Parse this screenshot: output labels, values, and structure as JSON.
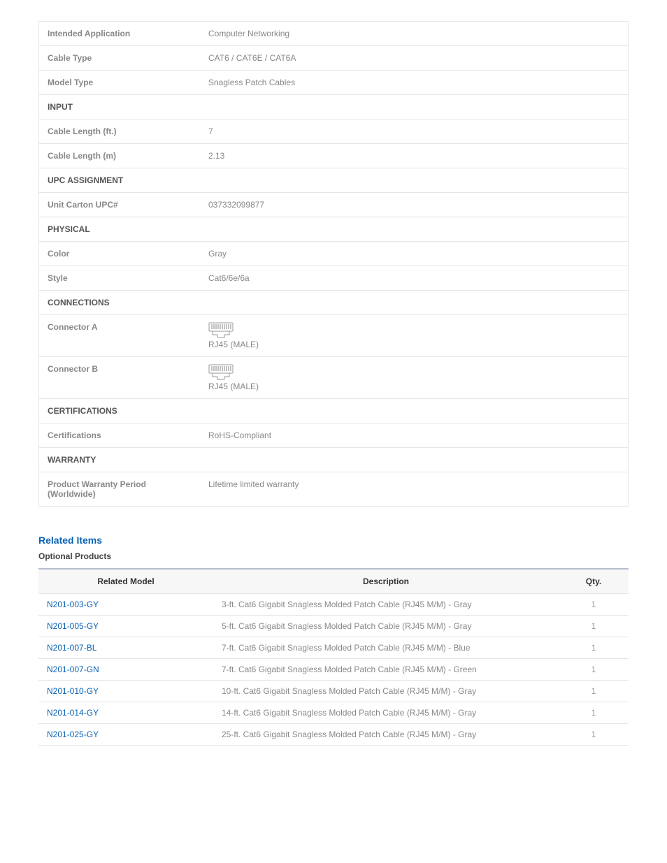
{
  "specs": {
    "intended_application": {
      "label": "Intended Application",
      "value": "Computer Networking"
    },
    "cable_type": {
      "label": "Cable Type",
      "value": "CAT6 / CAT6E / CAT6A"
    },
    "model_type": {
      "label": "Model Type",
      "value": "Snagless Patch Cables"
    },
    "input_section": "INPUT",
    "cable_length_ft": {
      "label": "Cable Length (ft.)",
      "value": "7"
    },
    "cable_length_m": {
      "label": "Cable Length (m)",
      "value": "2.13"
    },
    "upc_section": "UPC ASSIGNMENT",
    "unit_carton_upc": {
      "label": "Unit Carton UPC#",
      "value": "037332099877"
    },
    "physical_section": "PHYSICAL",
    "color": {
      "label": "Color",
      "value": "Gray"
    },
    "style": {
      "label": "Style",
      "value": "Cat6/6e/6a"
    },
    "connections_section": "CONNECTIONS",
    "connector_a": {
      "label": "Connector A",
      "value": "RJ45 (MALE)"
    },
    "connector_b": {
      "label": "Connector B",
      "value": "RJ45 (MALE)"
    },
    "certifications_section": "CERTIFICATIONS",
    "certifications": {
      "label": "Certifications",
      "value": "RoHS-Compliant"
    },
    "warranty_section": "WARRANTY",
    "warranty_period": {
      "label": "Product Warranty Period (Worldwide)",
      "value": "Lifetime limited warranty"
    }
  },
  "related": {
    "heading": "Related Items",
    "subheading": "Optional Products",
    "columns": {
      "model": "Related Model",
      "desc": "Description",
      "qty": "Qty."
    },
    "items": [
      {
        "model": "N201-003-GY",
        "desc": "3-ft. Cat6 Gigabit Snagless Molded Patch Cable (RJ45 M/M) - Gray",
        "qty": "1"
      },
      {
        "model": "N201-005-GY",
        "desc": "5-ft. Cat6 Gigabit Snagless Molded Patch Cable (RJ45 M/M) - Gray",
        "qty": "1"
      },
      {
        "model": "N201-007-BL",
        "desc": "7-ft. Cat6 Gigabit Snagless Molded Patch Cable (RJ45 M/M) - Blue",
        "qty": "1"
      },
      {
        "model": "N201-007-GN",
        "desc": "7-ft. Cat6 Gigabit Snagless Molded Patch Cable (RJ45 M/M) - Green",
        "qty": "1"
      },
      {
        "model": "N201-010-GY",
        "desc": "10-ft. Cat6 Gigabit Snagless Molded Patch Cable (RJ45 M/M) - Gray",
        "qty": "1"
      },
      {
        "model": "N201-014-GY",
        "desc": "14-ft. Cat6 Gigabit Snagless Molded Patch Cable (RJ45 M/M) - Gray",
        "qty": "1"
      },
      {
        "model": "N201-025-GY",
        "desc": "25-ft. Cat6 Gigabit Snagless Molded Patch Cable (RJ45 M/M) - Gray",
        "qty": "1"
      }
    ]
  }
}
